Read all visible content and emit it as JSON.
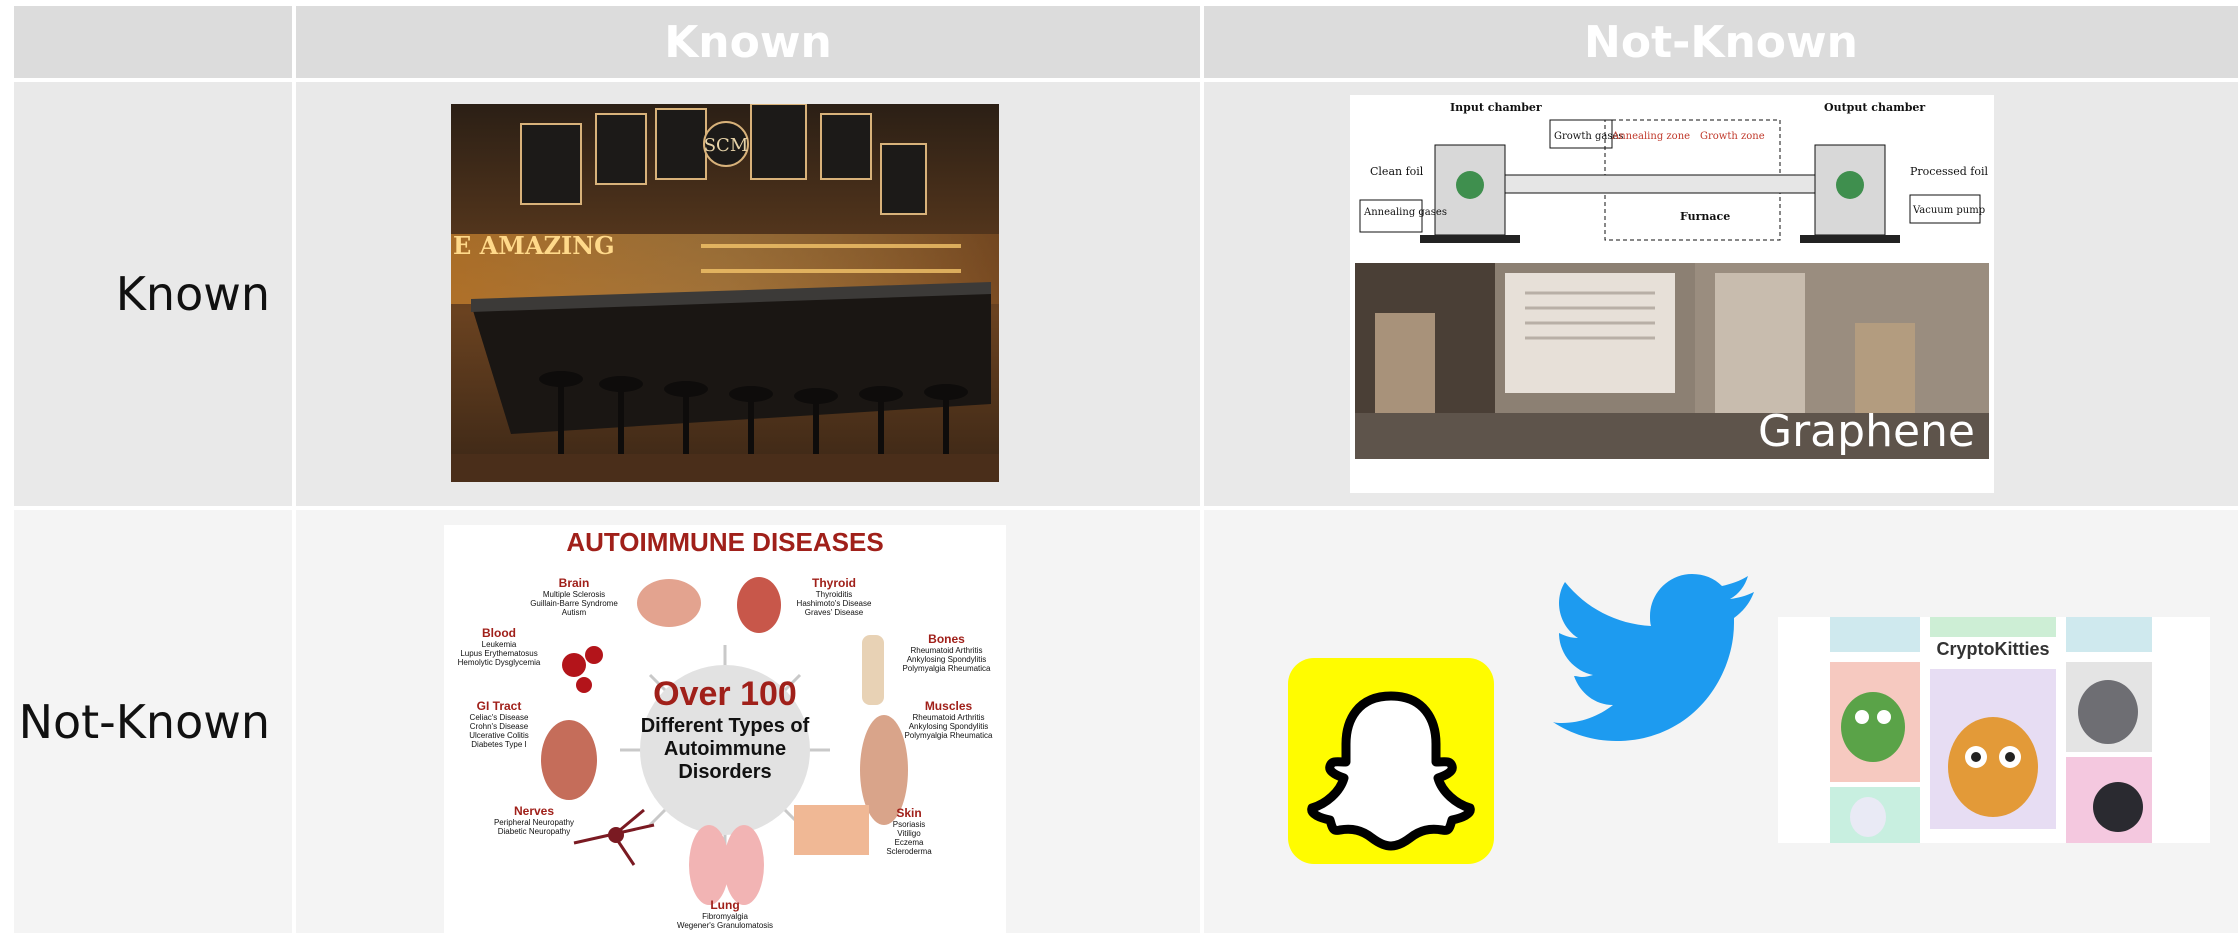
{
  "table": {
    "col_headers": [
      "Known",
      "Not-Known"
    ],
    "row_labels": [
      "Known",
      "Not-Known"
    ]
  },
  "cells": {
    "known_known": {
      "image": "restaurant-bar-photo",
      "sign_text": "E AMAZING",
      "logo_text": "SCM"
    },
    "known_notknown": {
      "image": "graphene-furnace-diagram",
      "diagram_labels": {
        "input": "Input chamber",
        "output": "Output chamber",
        "clean": "Clean foil",
        "growth_gases": "Growth gases",
        "annealing_zone": "Annealing zone",
        "growth_zone": "Growth zone",
        "processed": "Processed foil",
        "annealing_gases": "Annealing gases",
        "furnace": "Furnace",
        "vacuum": "Vacuum pump"
      },
      "caption": "Graphene"
    },
    "notknown_known": {
      "image": "autoimmune-diseases-infographic",
      "title": "AUTOIMMUNE DISEASES",
      "center_big": "Over 100",
      "center_line1": "Different Types of",
      "center_line2": "Autoimmune",
      "center_line3": "Disorders",
      "groups": [
        {
          "name": "Brain",
          "items": [
            "Multiple Sclerosis",
            "Guillain-Barre Syndrome",
            "Autism"
          ]
        },
        {
          "name": "Thyroid",
          "items": [
            "Thyroiditis",
            "Hashimoto's Disease",
            "Graves' Disease"
          ]
        },
        {
          "name": "Blood",
          "items": [
            "Leukemia",
            "Lupus Erythematosus",
            "Hemolytic Dysglycemia"
          ]
        },
        {
          "name": "Bones",
          "items": [
            "Rheumatoid Arthritis",
            "Ankylosing Spondylitis",
            "Polymyalgia Rheumatica"
          ]
        },
        {
          "name": "GI Tract",
          "items": [
            "Celiac's Disease",
            "Crohn's Disease",
            "Ulcerative Colitis",
            "Diabetes Type I"
          ]
        },
        {
          "name": "Muscles",
          "items": [
            "Rheumatoid Arthritis",
            "Ankylosing Spondylitis",
            "Polymyalgia Rheumatica"
          ]
        },
        {
          "name": "Nerves",
          "items": [
            "Peripheral Neuropathy",
            "Diabetic Neuropathy"
          ]
        },
        {
          "name": "Skin",
          "items": [
            "Psoriasis",
            "Vitiligo",
            "Eczema",
            "Scleroderma"
          ]
        },
        {
          "name": "Lung",
          "items": [
            "Fibromyalgia",
            "Wegener's Granulomatosis"
          ]
        }
      ]
    },
    "notknown_notknown": {
      "images": [
        "snapchat-logo",
        "twitter-bird-logo",
        "cryptokitties-image"
      ],
      "cryptokitties_title": "CryptoKitties"
    }
  },
  "colors": {
    "header_bg": "#dcdcdc",
    "row_a_bg": "#e9e9e9",
    "row_b_bg": "#f4f4f4",
    "snap_yellow": "#fffc00",
    "twitter_blue": "#1d9bf0",
    "autoimmune_red": "#a0201a"
  }
}
